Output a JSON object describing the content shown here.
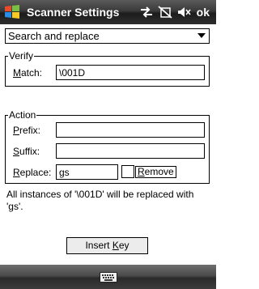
{
  "titlebar": {
    "title": "Scanner Settings",
    "ok_label": "ok"
  },
  "status_icons": [
    "connectivity-icon",
    "phone-off-icon",
    "volume-muted-icon"
  ],
  "dropdown": {
    "selected": "Search and replace"
  },
  "verify": {
    "group_label": "Verify",
    "match_label_accel": "M",
    "match_label_rest": "atch:",
    "match_value": "\\001D"
  },
  "action": {
    "group_label": "Action",
    "prefix_label_accel": "P",
    "prefix_label_rest": "refix:",
    "prefix_value": "",
    "suffix_label_accel": "S",
    "suffix_label_rest": "uffix:",
    "suffix_value": "",
    "replace_label_accel": "R",
    "replace_label_rest": "eplace:",
    "replace_value": "gs",
    "remove_label_accel": "R",
    "remove_label_rest": "emove",
    "remove_checked": false
  },
  "info": {
    "text": "All instances of '\\001D' will be replaced with 'gs'."
  },
  "insert_key": {
    "label_pre": "Insert ",
    "label_accel": "K",
    "label_post": "ey"
  }
}
